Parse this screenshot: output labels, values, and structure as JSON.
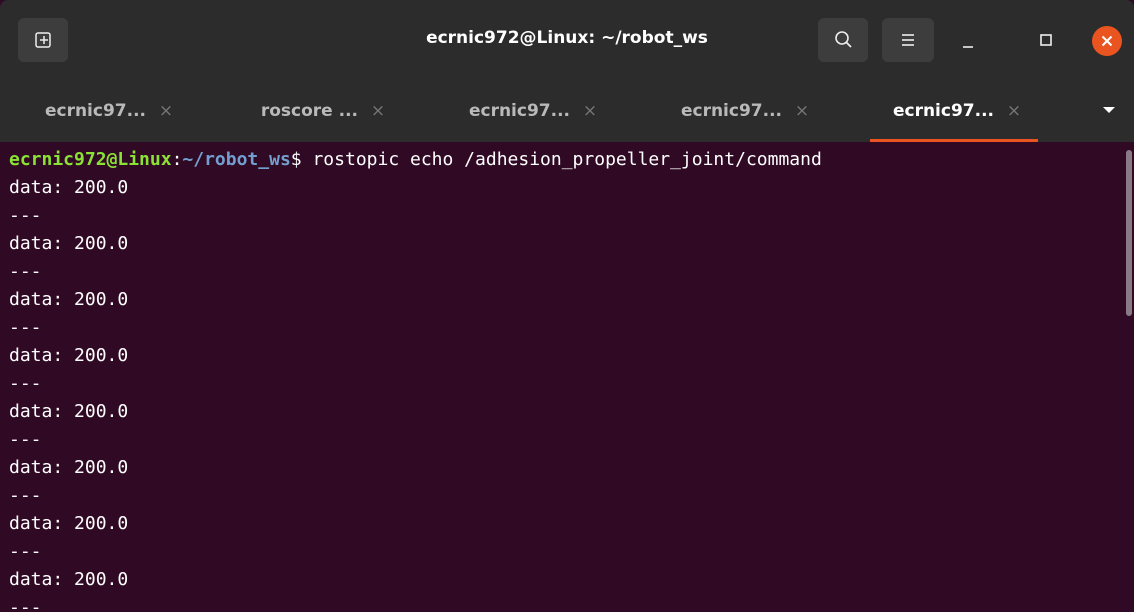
{
  "window": {
    "title": "ecrnic972@Linux: ~/robot_ws"
  },
  "header": {
    "new_tab_icon": "new-tab-icon",
    "search_icon": "search-icon",
    "menu_icon": "hamburger-menu-icon",
    "minimize_icon": "minimize-icon",
    "maximize_icon": "maximize-icon",
    "close_icon": "close-icon"
  },
  "tabs": [
    {
      "label": "ecrnic97...",
      "active": false
    },
    {
      "label": "roscore ...",
      "active": false
    },
    {
      "label": "ecrnic97...",
      "active": false
    },
    {
      "label": "ecrnic97...",
      "active": false
    },
    {
      "label": "ecrnic97...",
      "active": true
    }
  ],
  "tab_close_glyph": "×",
  "terminal": {
    "prompt": {
      "user_host": "ecrnic972@Linux",
      "separator": ":",
      "path": "~/robot_ws",
      "symbol": "$ "
    },
    "command": "rostopic echo /adhesion_propeller_joint/command",
    "output": [
      "data: 200.0",
      "---",
      "data: 200.0",
      "---",
      "data: 200.0",
      "---",
      "data: 200.0",
      "---",
      "data: 200.0",
      "---",
      "data: 200.0",
      "---",
      "data: 200.0",
      "---",
      "data: 200.0",
      "---"
    ]
  },
  "colors": {
    "terminal_bg": "#300a24",
    "header_bg": "#2c2c2c",
    "accent": "#e95420",
    "prompt_user": "#8ae234",
    "prompt_path": "#729fcf"
  }
}
